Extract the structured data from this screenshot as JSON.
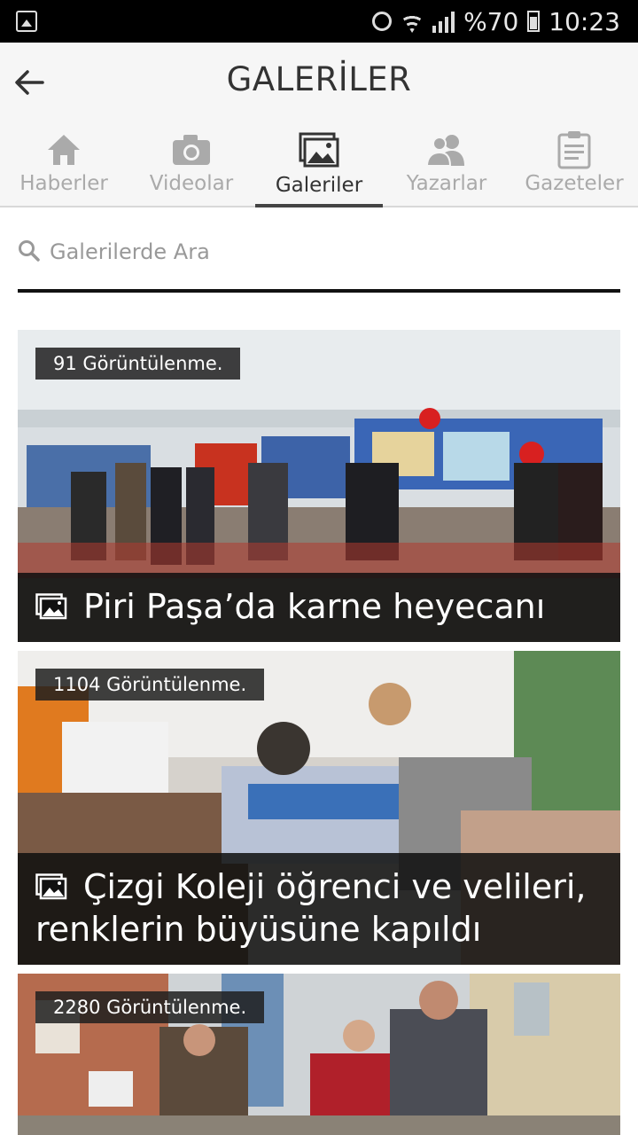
{
  "status_bar": {
    "battery": "%70",
    "time": "10:23"
  },
  "header": {
    "title": "GALERİLER"
  },
  "tabs": [
    {
      "label": "Haberler",
      "icon": "house-icon"
    },
    {
      "label": "Videolar",
      "icon": "camera-icon"
    },
    {
      "label": "Galeriler",
      "icon": "gallery-icon",
      "active": true
    },
    {
      "label": "Yazarlar",
      "icon": "users-icon"
    },
    {
      "label": "Gazeteler",
      "icon": "clipboard-icon"
    }
  ],
  "search": {
    "placeholder": "Galerilerde Ara"
  },
  "galleries": [
    {
      "views": "91 Görüntülenme.",
      "title": "Piri Paşa’da karne heyecanı"
    },
    {
      "views": "1104 Görüntülenme.",
      "title": "Çizgi Koleji öğrenci ve velileri, renklerin büyüsüne kapıldı"
    },
    {
      "views": "2280 Görüntülenme.",
      "title": ""
    }
  ],
  "colors": {
    "active_tab": "#333333",
    "inactive_tab": "#aaaaaa",
    "caption_bg": "#0f0f0f"
  }
}
